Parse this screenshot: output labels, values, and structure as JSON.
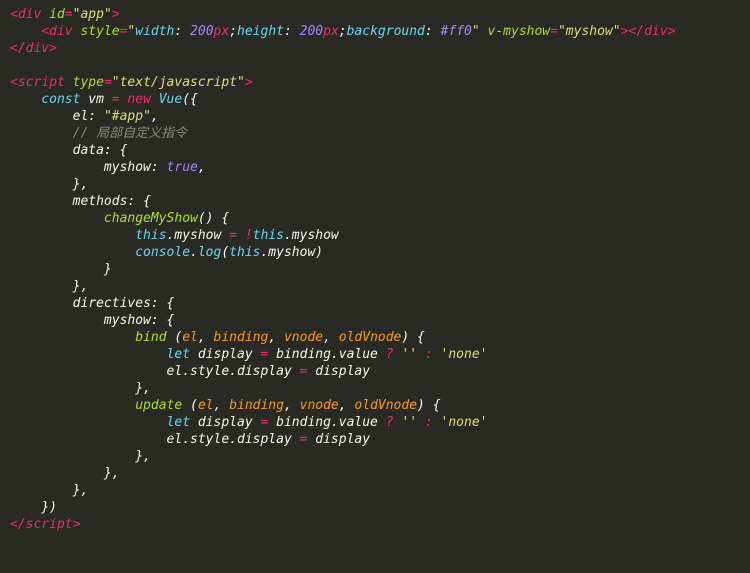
{
  "code": {
    "lines": [
      {
        "i": 0,
        "seg": [
          [
            "p",
            "<"
          ],
          [
            "p",
            "div"
          ],
          [
            "w",
            " "
          ],
          [
            "a",
            "id"
          ],
          [
            "k",
            "="
          ],
          [
            "s",
            "\"app\""
          ],
          [
            "p",
            ">"
          ]
        ]
      },
      {
        "i": 1,
        "seg": [
          [
            "p",
            "<"
          ],
          [
            "p",
            "div"
          ],
          [
            "w",
            " "
          ],
          [
            "a",
            "style"
          ],
          [
            "k",
            "="
          ],
          [
            "s",
            "\""
          ],
          [
            "fn",
            "width"
          ],
          [
            "w",
            ": "
          ],
          [
            "n",
            "200"
          ],
          [
            "p",
            "px"
          ],
          [
            "w",
            ";"
          ],
          [
            "fn",
            "height"
          ],
          [
            "w",
            ": "
          ],
          [
            "n",
            "200"
          ],
          [
            "p",
            "px"
          ],
          [
            "w",
            ";"
          ],
          [
            "fn",
            "background"
          ],
          [
            "w",
            ": "
          ],
          [
            "n",
            "#ff0"
          ],
          [
            "s",
            "\""
          ],
          [
            "w",
            " "
          ],
          [
            "a",
            "v-myshow"
          ],
          [
            "k",
            "="
          ],
          [
            "s",
            "\"myshow\""
          ],
          [
            "p",
            "></"
          ],
          [
            "p",
            "div"
          ],
          [
            "p",
            ">"
          ]
        ]
      },
      {
        "i": 0,
        "seg": [
          [
            "p",
            "</"
          ],
          [
            "p",
            "div"
          ],
          [
            "p",
            ">"
          ]
        ]
      },
      {
        "i": 0,
        "seg": [
          [
            "w",
            ""
          ]
        ]
      },
      {
        "i": 0,
        "seg": [
          [
            "p",
            "<"
          ],
          [
            "p",
            "script"
          ],
          [
            "w",
            " "
          ],
          [
            "a",
            "type"
          ],
          [
            "k",
            "="
          ],
          [
            "s",
            "\"text/javascript\""
          ],
          [
            "p",
            ">"
          ]
        ]
      },
      {
        "i": 1,
        "seg": [
          [
            "fn",
            "const"
          ],
          [
            "w",
            " vm "
          ],
          [
            "k",
            "="
          ],
          [
            "w",
            " "
          ],
          [
            "k",
            "new"
          ],
          [
            "w",
            " "
          ],
          [
            "fn",
            "Vue"
          ],
          [
            "w",
            "({"
          ]
        ]
      },
      {
        "i": 2,
        "seg": [
          [
            "w",
            "el: "
          ],
          [
            "s",
            "\"#app\""
          ],
          [
            "w",
            ","
          ]
        ]
      },
      {
        "i": 2,
        "seg": [
          [
            "c",
            "// 局部自定义指令"
          ]
        ]
      },
      {
        "i": 2,
        "seg": [
          [
            "w",
            "data: {"
          ]
        ]
      },
      {
        "i": 3,
        "seg": [
          [
            "w",
            "myshow: "
          ],
          [
            "n",
            "true"
          ],
          [
            "w",
            ","
          ]
        ]
      },
      {
        "i": 2,
        "seg": [
          [
            "w",
            "},"
          ]
        ]
      },
      {
        "i": 2,
        "seg": [
          [
            "w",
            "methods: {"
          ]
        ]
      },
      {
        "i": 3,
        "seg": [
          [
            "a",
            "changeMyShow"
          ],
          [
            "w",
            "() {"
          ]
        ]
      },
      {
        "i": 4,
        "seg": [
          [
            "fn",
            "this"
          ],
          [
            "w",
            ".myshow "
          ],
          [
            "k",
            "="
          ],
          [
            "w",
            " "
          ],
          [
            "k",
            "!"
          ],
          [
            "fn",
            "this"
          ],
          [
            "w",
            ".myshow"
          ]
        ]
      },
      {
        "i": 4,
        "seg": [
          [
            "fn",
            "console"
          ],
          [
            "w",
            "."
          ],
          [
            "fn",
            "log"
          ],
          [
            "w",
            "("
          ],
          [
            "fn",
            "this"
          ],
          [
            "w",
            ".myshow)"
          ]
        ]
      },
      {
        "i": 3,
        "seg": [
          [
            "w",
            "}"
          ]
        ]
      },
      {
        "i": 2,
        "seg": [
          [
            "w",
            "},"
          ]
        ]
      },
      {
        "i": 2,
        "seg": [
          [
            "w",
            "directives: {"
          ]
        ]
      },
      {
        "i": 3,
        "seg": [
          [
            "w",
            "myshow: {"
          ]
        ]
      },
      {
        "i": 4,
        "seg": [
          [
            "a",
            "bind"
          ],
          [
            "w",
            " ("
          ],
          [
            "o",
            "el"
          ],
          [
            "w",
            ", "
          ],
          [
            "o",
            "binding"
          ],
          [
            "w",
            ", "
          ],
          [
            "o",
            "vnode"
          ],
          [
            "w",
            ", "
          ],
          [
            "o",
            "oldVnode"
          ],
          [
            "w",
            ") {"
          ]
        ]
      },
      {
        "i": 5,
        "seg": [
          [
            "fn",
            "let"
          ],
          [
            "w",
            " display "
          ],
          [
            "k",
            "="
          ],
          [
            "w",
            " binding.value "
          ],
          [
            "k",
            "?"
          ],
          [
            "w",
            " "
          ],
          [
            "s",
            "''"
          ],
          [
            "w",
            " "
          ],
          [
            "k",
            ":"
          ],
          [
            "w",
            " "
          ],
          [
            "s",
            "'none'"
          ]
        ]
      },
      {
        "i": 5,
        "seg": [
          [
            "w",
            "el.style.display "
          ],
          [
            "k",
            "="
          ],
          [
            "w",
            " display"
          ]
        ]
      },
      {
        "i": 4,
        "seg": [
          [
            "w",
            "},"
          ]
        ]
      },
      {
        "i": 4,
        "seg": [
          [
            "a",
            "update"
          ],
          [
            "w",
            " ("
          ],
          [
            "o",
            "el"
          ],
          [
            "w",
            ", "
          ],
          [
            "o",
            "binding"
          ],
          [
            "w",
            ", "
          ],
          [
            "o",
            "vnode"
          ],
          [
            "w",
            ", "
          ],
          [
            "o",
            "oldVnode"
          ],
          [
            "w",
            ") {"
          ]
        ]
      },
      {
        "i": 5,
        "seg": [
          [
            "fn",
            "let"
          ],
          [
            "w",
            " display "
          ],
          [
            "k",
            "="
          ],
          [
            "w",
            " binding.value "
          ],
          [
            "k",
            "?"
          ],
          [
            "w",
            " "
          ],
          [
            "s",
            "''"
          ],
          [
            "w",
            " "
          ],
          [
            "k",
            ":"
          ],
          [
            "w",
            " "
          ],
          [
            "s",
            "'none'"
          ]
        ]
      },
      {
        "i": 5,
        "seg": [
          [
            "w",
            "el.style.display "
          ],
          [
            "k",
            "="
          ],
          [
            "w",
            " display"
          ]
        ]
      },
      {
        "i": 4,
        "seg": [
          [
            "w",
            "},"
          ]
        ]
      },
      {
        "i": 3,
        "seg": [
          [
            "w",
            "},"
          ]
        ]
      },
      {
        "i": 2,
        "seg": [
          [
            "w",
            "},"
          ]
        ]
      },
      {
        "i": 1,
        "seg": [
          [
            "w",
            "})"
          ]
        ]
      },
      {
        "i": 0,
        "seg": [
          [
            "p",
            "</"
          ],
          [
            "p",
            "script"
          ],
          [
            "p",
            ">"
          ]
        ]
      }
    ],
    "indent_unit": "    "
  }
}
